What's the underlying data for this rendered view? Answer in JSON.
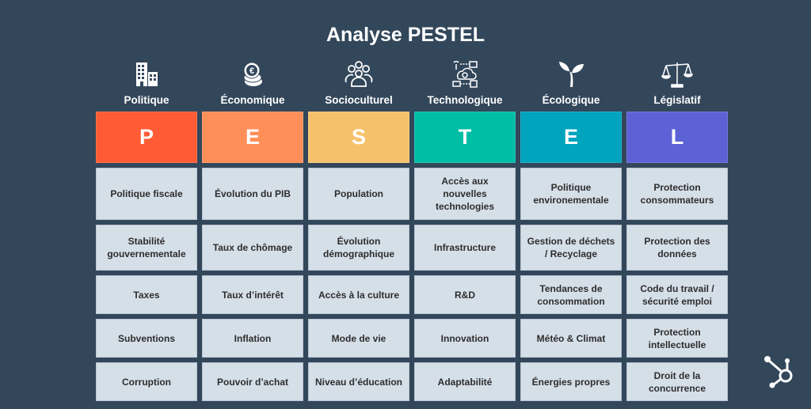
{
  "title": "Analyse PESTEL",
  "columns": [
    {
      "icon": "buildings-icon",
      "label": "Politique",
      "letter": "P",
      "color": "#ff5c35",
      "items": [
        "Politique fiscale",
        "Stabilité gouvernementale",
        "Taxes",
        "Subventions",
        "Corruption"
      ]
    },
    {
      "icon": "euro-coins-icon",
      "label": "Économique",
      "letter": "E",
      "color": "#ff8f59",
      "items": [
        "Évolution du PIB",
        "Taux de chômage",
        "Taux d’intérêt",
        "Inflation",
        "Pouvoir d’achat"
      ]
    },
    {
      "icon": "people-group-icon",
      "label": "Socioculturel",
      "letter": "S",
      "color": "#f5c26b",
      "items": [
        "Population",
        "Évolution démographique",
        "Accès à la culture",
        "Mode de vie",
        "Niveau d’éducation"
      ]
    },
    {
      "icon": "technology-network-icon",
      "label": "Technologique",
      "letter": "T",
      "color": "#00bda5",
      "items": [
        "Accès aux nouvelles technologies",
        "Infrastructure",
        "R&D",
        "Innovation",
        "Adaptabilité"
      ]
    },
    {
      "icon": "plant-sprout-icon",
      "label": "Écologique",
      "letter": "E",
      "color": "#00a4bd",
      "items": [
        "Politique environementale",
        "Gestion de déchets / Recyclage",
        "Tendances de consommation",
        "Météo & Climat",
        "Énergies propres"
      ]
    },
    {
      "icon": "scales-of-justice-icon",
      "label": "Législatif",
      "letter": "L",
      "color": "#5c62d6",
      "items": [
        "Protection consommateurs",
        "Protection des données",
        "Code du travail / sécurité emploi",
        "Protection intellectuelle",
        "Droit de la concurrence"
      ]
    }
  ],
  "logo": "hubspot-sprocket-icon"
}
